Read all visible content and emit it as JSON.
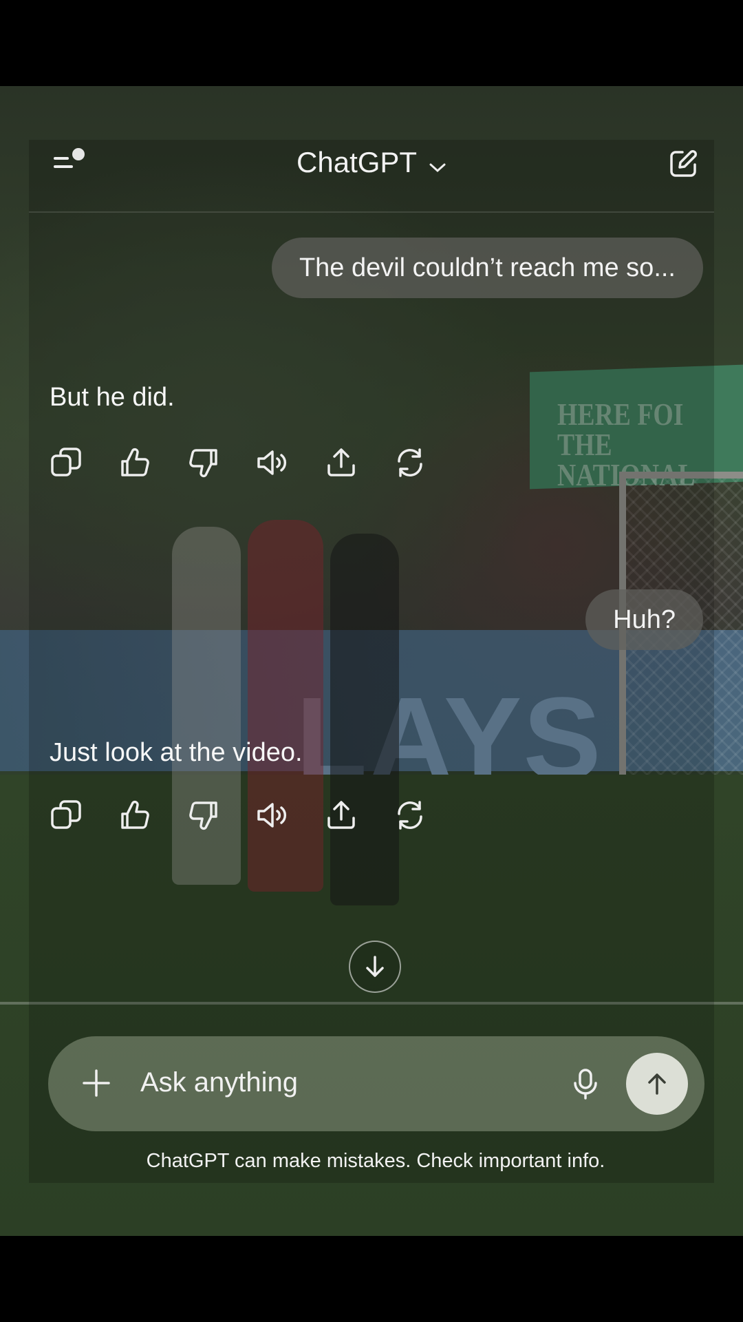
{
  "header": {
    "title": "ChatGPT",
    "menu_icon": "sidebar-menu-icon",
    "title_icon": "chevron-down-icon",
    "new_chat_icon": "compose-icon"
  },
  "messages": [
    {
      "role": "user",
      "text": "The devil couldn’t reach me so..."
    },
    {
      "role": "assistant",
      "text": "But he did."
    },
    {
      "role": "user",
      "text": "Huh?"
    },
    {
      "role": "assistant",
      "text": "Just look at the video."
    }
  ],
  "message_actions": [
    "copy-icon",
    "thumbs-up-icon",
    "thumbs-down-icon",
    "read-aloud-icon",
    "share-icon",
    "regenerate-icon"
  ],
  "composer": {
    "placeholder": "Ask anything",
    "attach_icon": "plus-icon",
    "mic_icon": "microphone-icon",
    "send_icon": "arrow-up-icon"
  },
  "scroll_down_icon": "arrow-down-icon",
  "disclaimer": "ChatGPT can make mistakes. Check important info.",
  "background_video": {
    "banner_text": "LAYS",
    "sign_text_line1": "HERE FOI",
    "sign_text_line2": "THE NATIONAL"
  },
  "colors": {
    "accent_send": "#dcdfd6",
    "bubble": "#5f5f5c",
    "composer": "#808c76"
  }
}
